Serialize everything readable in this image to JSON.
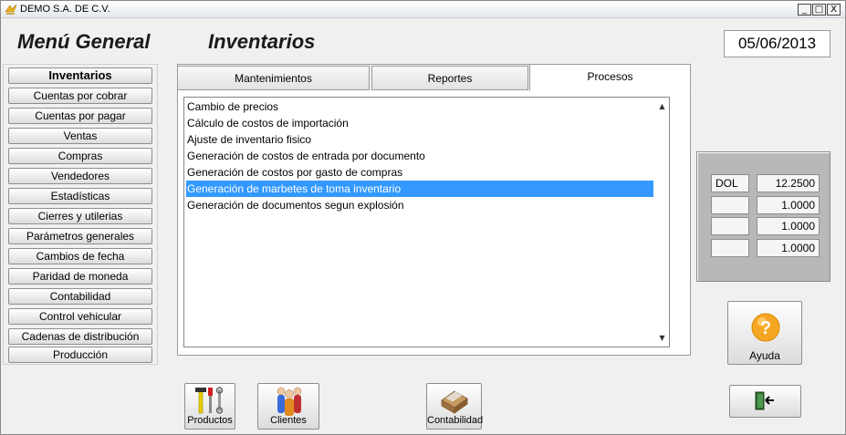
{
  "window": {
    "title": "DEMO  S.A. DE C.V.",
    "controls": [
      "_",
      "□",
      "X"
    ]
  },
  "header": {
    "menu_title": "Menú General",
    "section_title": "Inventarios",
    "date": "05/06/2013"
  },
  "sidebar": {
    "items": [
      {
        "label": "Inventarios",
        "active": true
      },
      {
        "label": "Cuentas por cobrar"
      },
      {
        "label": "Cuentas por pagar"
      },
      {
        "label": "Ventas"
      },
      {
        "label": "Compras"
      },
      {
        "label": "Vendedores"
      },
      {
        "label": "Estadísticas"
      },
      {
        "label": "Cierres y utilerias"
      },
      {
        "label": "Parámetros generales"
      },
      {
        "label": "Cambios de fecha"
      },
      {
        "label": "Paridad de moneda"
      },
      {
        "label": "Contabilidad"
      },
      {
        "label": "Control vehicular"
      },
      {
        "label": "Cadenas de distribución"
      },
      {
        "label": "Producción"
      }
    ]
  },
  "tabs": [
    {
      "label": "Mantenimientos"
    },
    {
      "label": "Reportes"
    },
    {
      "label": "Procesos",
      "active": true
    }
  ],
  "list": {
    "items": [
      "Cambio de precios",
      "Cálculo de costos de importación",
      "Ajuste de inventario fisico",
      "Generación de costos de entrada por documento",
      "Generación de costos por gasto de compras",
      "Generación de marbetes de toma inventario",
      "Generación de documentos segun explosión"
    ],
    "selected_index": 5
  },
  "currency": {
    "rows": [
      {
        "code": "DOL",
        "rate": "12.2500"
      },
      {
        "code": "",
        "rate": "1.0000"
      },
      {
        "code": "",
        "rate": "1.0000"
      },
      {
        "code": "",
        "rate": "1.0000"
      }
    ]
  },
  "buttons": {
    "help_label": "Ayuda",
    "productos_label": "Productos",
    "clientes_label": "Clientes",
    "contabilidad_label": "Contabilidad",
    "exit_icon": "exit-door-icon"
  },
  "colors": {
    "selection": "#3399ff",
    "background": "#f0f0f0",
    "currency_panel": "#b8b8b8",
    "help_icon": "#f5a623"
  }
}
